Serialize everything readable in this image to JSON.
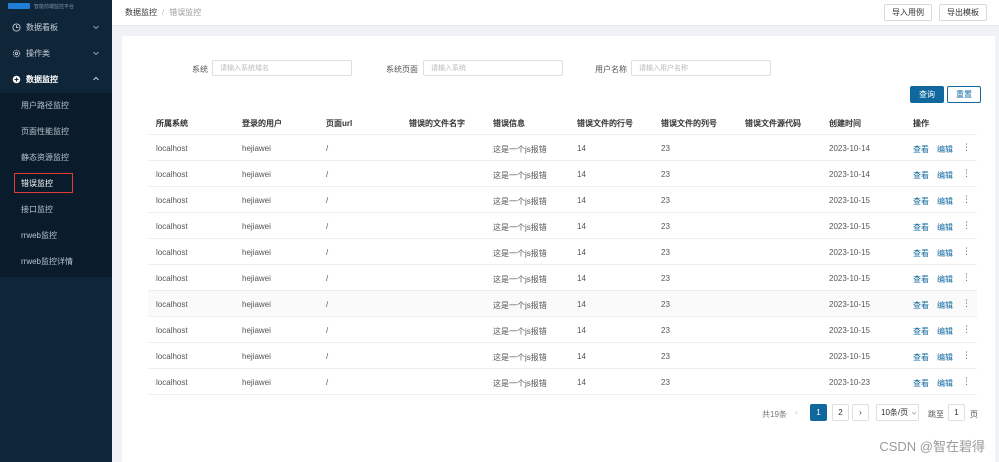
{
  "sidebar": {
    "logo_text": "智能前端监控平台",
    "items": [
      {
        "label": "数据看板",
        "icon": "clock-icon"
      },
      {
        "label": "操作类",
        "icon": "gear-icon"
      },
      {
        "label": "数据监控",
        "icon": "plus-circle-icon"
      }
    ],
    "sub_items": [
      {
        "label": "用户路径监控"
      },
      {
        "label": "页面性能监控"
      },
      {
        "label": "静态资源监控"
      },
      {
        "label": "错误监控"
      },
      {
        "label": "接口监控"
      },
      {
        "label": "rrweb监控"
      },
      {
        "label": "rrweb监控详情"
      }
    ],
    "active_sub": "错误监控"
  },
  "breadcrumb": {
    "parent": "数据监控",
    "separator": "/",
    "current": "错误监控"
  },
  "toolbar": {
    "import_label": "导入用例",
    "export_label": "导出模板"
  },
  "filters": {
    "system": {
      "label": "系统",
      "placeholder": "请输入系统域名"
    },
    "page": {
      "label": "系统页面",
      "placeholder": "请输入系统"
    },
    "user": {
      "label": "用户名称",
      "placeholder": "请输入用户名称"
    },
    "search_label": "查询",
    "reset_label": "重置"
  },
  "table": {
    "headers": [
      "所属系统",
      "登录的用户",
      "页面url",
      "错误的文件名字",
      "错误信息",
      "错误文件的行号",
      "错误文件的列号",
      "错误文件源代码",
      "创建时间",
      "操作"
    ],
    "rows": [
      {
        "system": "localhost",
        "user": "hejiawei",
        "url": "/",
        "filename": "",
        "message": "这是一个js报错",
        "line": "14",
        "column": "23",
        "source": "",
        "created": "2023-10-14"
      },
      {
        "system": "localhost",
        "user": "hejiawei",
        "url": "/",
        "filename": "",
        "message": "这是一个js报错",
        "line": "14",
        "column": "23",
        "source": "",
        "created": "2023-10-14"
      },
      {
        "system": "localhost",
        "user": "hejiawei",
        "url": "/",
        "filename": "",
        "message": "这是一个js报错",
        "line": "14",
        "column": "23",
        "source": "",
        "created": "2023-10-15"
      },
      {
        "system": "localhost",
        "user": "hejiawei",
        "url": "/",
        "filename": "",
        "message": "这是一个js报错",
        "line": "14",
        "column": "23",
        "source": "",
        "created": "2023-10-15"
      },
      {
        "system": "localhost",
        "user": "hejiawei",
        "url": "/",
        "filename": "",
        "message": "这是一个js报错",
        "line": "14",
        "column": "23",
        "source": "",
        "created": "2023-10-15"
      },
      {
        "system": "localhost",
        "user": "hejiawei",
        "url": "/",
        "filename": "",
        "message": "这是一个js报错",
        "line": "14",
        "column": "23",
        "source": "",
        "created": "2023-10-15"
      },
      {
        "system": "localhost",
        "user": "hejiawei",
        "url": "/",
        "filename": "",
        "message": "这是一个js报错",
        "line": "14",
        "column": "23",
        "source": "",
        "created": "2023-10-15"
      },
      {
        "system": "localhost",
        "user": "hejiawei",
        "url": "/",
        "filename": "",
        "message": "这是一个js报错",
        "line": "14",
        "column": "23",
        "source": "",
        "created": "2023-10-15"
      },
      {
        "system": "localhost",
        "user": "hejiawei",
        "url": "/",
        "filename": "",
        "message": "这是一个js报错",
        "line": "14",
        "column": "23",
        "source": "",
        "created": "2023-10-15"
      },
      {
        "system": "localhost",
        "user": "hejiawei",
        "url": "/",
        "filename": "",
        "message": "这是一个js报错",
        "line": "14",
        "column": "23",
        "source": "",
        "created": "2023-10-23"
      }
    ],
    "action_view": "查看",
    "action_edit": "编辑",
    "action_more": "⋮"
  },
  "pagination": {
    "total_text": "共19条",
    "prev": "‹",
    "next": "›",
    "pages": [
      "1",
      "2"
    ],
    "current_page": "1",
    "page_size": "10条/页",
    "jump_label": "跳至",
    "jump_value": "1",
    "page_unit": "页"
  },
  "watermark": "CSDN @智在碧得",
  "colors": {
    "primary": "#11689f",
    "sidebar_bg": "#0f2639",
    "highlight_border": "#e53935"
  }
}
